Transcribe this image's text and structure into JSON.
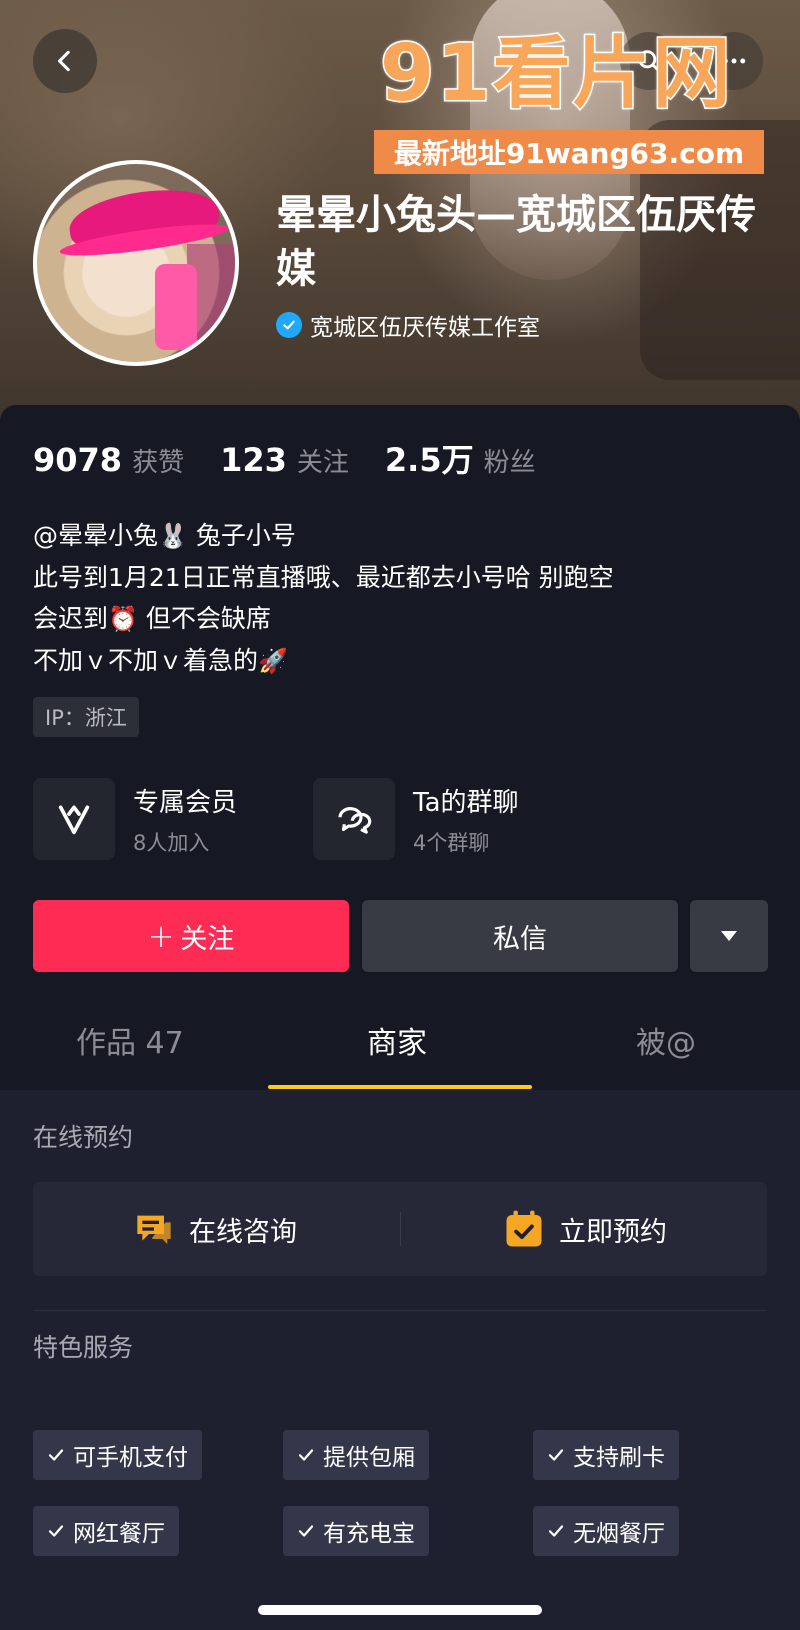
{
  "header": {
    "profile_name": "晕晕小兔头—宽城区伍厌传媒",
    "verified_text": "宽城区伍厌传媒工作室"
  },
  "watermark": {
    "logo_text": "91看片网",
    "address_text": "最新地址91wang63.com"
  },
  "stats": [
    {
      "value": "9078",
      "label": "获赞"
    },
    {
      "value": "123",
      "label": "关注"
    },
    {
      "value": "2.5万",
      "label": "粉丝"
    }
  ],
  "bio": {
    "line1_a": "@晕晕小兔",
    "line1_emoji": "🐰",
    "line1_b": " 兔子小号",
    "line2": "此号到1月21日正常直播哦、最近都去小号哈 别跑空",
    "line3_a": "会迟到",
    "line3_emoji": "⏰",
    "line3_b": " 但不会缺席",
    "line4_a": "不加ｖ不加ｖ着急的",
    "line4_emoji": "🚀"
  },
  "ip": "IP：浙江",
  "features": [
    {
      "title": "专属会员",
      "sub": "8人加入"
    },
    {
      "title": "Ta的群聊",
      "sub": "4个群聊"
    }
  ],
  "actions": {
    "follow": "关注",
    "follow_prefix": "+",
    "message": "私信"
  },
  "tabs": [
    {
      "label": "作品 47",
      "active": false
    },
    {
      "label": "商家",
      "active": true
    },
    {
      "label": "被@",
      "active": false
    }
  ],
  "merchant": {
    "booking_title": "在线预约",
    "consult": "在线咨询",
    "reserve": "立即预约",
    "services_title": "特色服务",
    "services": [
      "可手机支付",
      "提供包厢",
      "支持刷卡",
      "网红餐厅",
      "有充电宝",
      "无烟餐厅"
    ]
  },
  "colors": {
    "accent": "#fe2c55",
    "tab_underline": "#face15",
    "booking_icon": "#f5a623",
    "verified": "#20a8ff"
  },
  "icons": {
    "back": "chevron-left-icon",
    "search": "search-icon",
    "more": "more-horizontal-icon",
    "verified": "verified-check-icon",
    "member": "v-member-icon",
    "group": "chat-bubbles-icon",
    "dropdown": "triangle-down-icon",
    "consult": "chat-orange-icon",
    "reserve": "calendar-check-icon",
    "service_check": "check-icon"
  }
}
